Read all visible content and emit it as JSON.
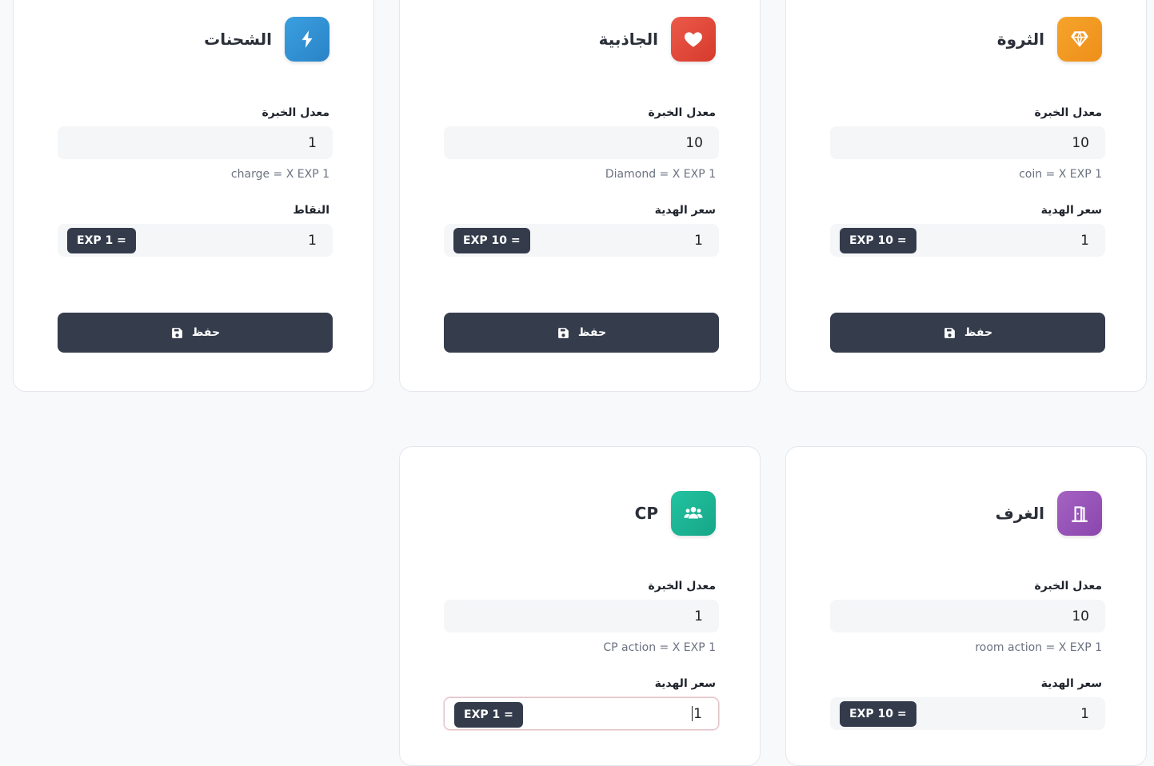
{
  "cards": [
    {
      "id": "wealth",
      "title": "الثروة",
      "icon": "diamond-icon",
      "color": "#f39c22",
      "exp_label": "معدل الخبرة",
      "exp_value": "10",
      "hint": "coin = X EXP 1",
      "price_label": "سعر الهدية",
      "price_value": "1",
      "badge": "EXP 10 =",
      "save_label": "حفظ"
    },
    {
      "id": "charm",
      "title": "الجاذبية",
      "icon": "heart-icon",
      "color": "#e74c3c",
      "exp_label": "معدل الخبرة",
      "exp_value": "10",
      "hint": "Diamond = X EXP 1",
      "price_label": "سعر الهدية",
      "price_value": "1",
      "badge": "EXP 10 =",
      "save_label": "حفظ"
    },
    {
      "id": "charges",
      "title": "الشحنات",
      "icon": "bolt-icon",
      "color": "#3498db",
      "exp_label": "معدل الخبرة",
      "exp_value": "1",
      "hint": "charge = X EXP 1",
      "price_label": "النقاط",
      "price_value": "1",
      "badge": "EXP 1 =",
      "save_label": "حفظ"
    },
    {
      "id": "rooms",
      "title": "الغرف",
      "icon": "door-icon",
      "color": "#9b59b6",
      "exp_label": "معدل الخبرة",
      "exp_value": "10",
      "hint": "room action = X EXP 1",
      "price_label": "سعر الهدية",
      "price_value": "1",
      "badge": "EXP 10 ="
    },
    {
      "id": "cp",
      "title": "CP",
      "icon": "users-icon",
      "color": "#1abc9c",
      "exp_label": "معدل الخبرة",
      "exp_value": "1",
      "hint": "CP action = X EXP 1",
      "price_label": "سعر الهدية",
      "price_value": "1",
      "badge": "EXP 1 ="
    }
  ]
}
